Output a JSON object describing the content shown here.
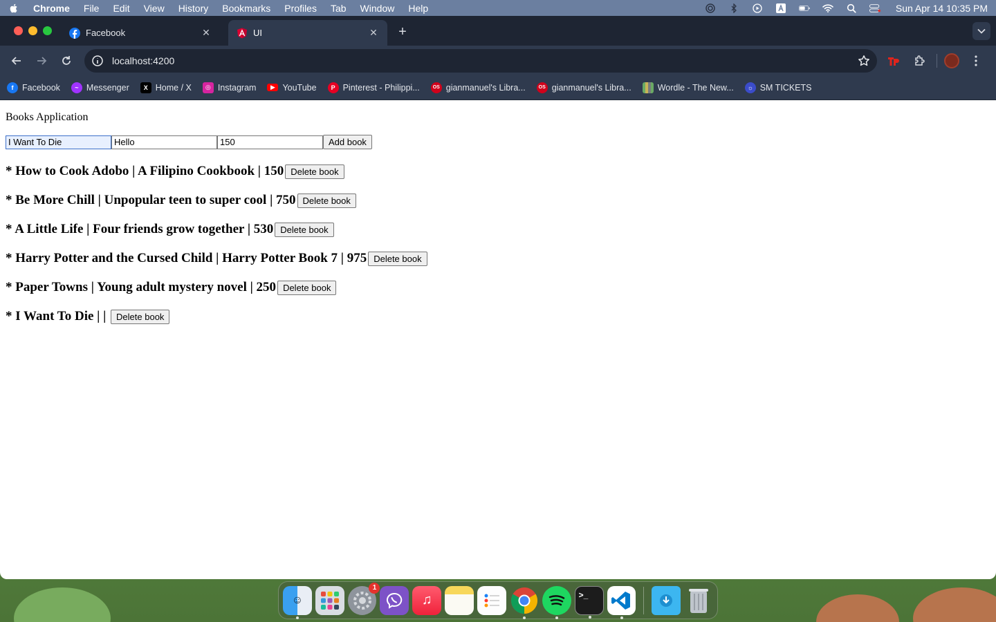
{
  "menubar": {
    "app_name": "Chrome",
    "items": [
      "File",
      "Edit",
      "View",
      "History",
      "Bookmarks",
      "Profiles",
      "Tab",
      "Window",
      "Help"
    ],
    "clock": "Sun Apr 14  10:35 PM"
  },
  "tabs": [
    {
      "title": "Facebook",
      "icon": "facebook-icon",
      "active": false
    },
    {
      "title": "UI",
      "icon": "angular-icon",
      "active": true
    }
  ],
  "toolbar": {
    "url": "localhost:4200"
  },
  "bookmarks": [
    {
      "label": "Facebook",
      "icon": "facebook-icon",
      "color": "#1877f2"
    },
    {
      "label": "Messenger",
      "icon": "messenger-icon",
      "color": "#a033ff"
    },
    {
      "label": "Home / X",
      "icon": "x-icon",
      "color": "#000000"
    },
    {
      "label": "Instagram",
      "icon": "instagram-icon",
      "color": "#d6249f"
    },
    {
      "label": "YouTube",
      "icon": "youtube-icon",
      "color": "#ff0000"
    },
    {
      "label": "Pinterest - Philippi...",
      "icon": "pinterest-icon",
      "color": "#e60023"
    },
    {
      "label": "gianmanuel's Libra...",
      "icon": "os-icon",
      "color": "#d0021b"
    },
    {
      "label": "gianmanuel's Libra...",
      "icon": "os-icon",
      "color": "#d0021b"
    },
    {
      "label": "Wordle - The New...",
      "icon": "wordle-icon",
      "color": "#6aaa64"
    },
    {
      "label": "SM TICKETS",
      "icon": "sm-tickets-icon",
      "color": "#3b4cca"
    }
  ],
  "page": {
    "title": "Books Application",
    "form": {
      "title_value": "I Want To Die",
      "description_value": "Hello",
      "price_value": "150",
      "add_label": "Add book"
    },
    "delete_label": "Delete book",
    "books": [
      "* How to Cook Adobo | A Filipino Cookbook | 150",
      "* Be More Chill | Unpopular teen to super cool | 750",
      "* A Little Life | Four friends grow together | 530",
      "* Harry Potter and the Cursed Child | Harry Potter Book 7 | 975",
      "* Paper Towns | Young adult mystery novel | 250",
      "* I Want To Die | | "
    ]
  },
  "dock": {
    "apps": [
      "finder-icon",
      "launchpad-icon",
      "system-settings-icon",
      "viber-icon",
      "music-icon",
      "notes-icon",
      "reminders-icon",
      "chrome-icon",
      "spotify-icon",
      "terminal-icon",
      "vscode-icon",
      "downloads-icon",
      "trash-icon"
    ],
    "settings_badge": "1"
  }
}
